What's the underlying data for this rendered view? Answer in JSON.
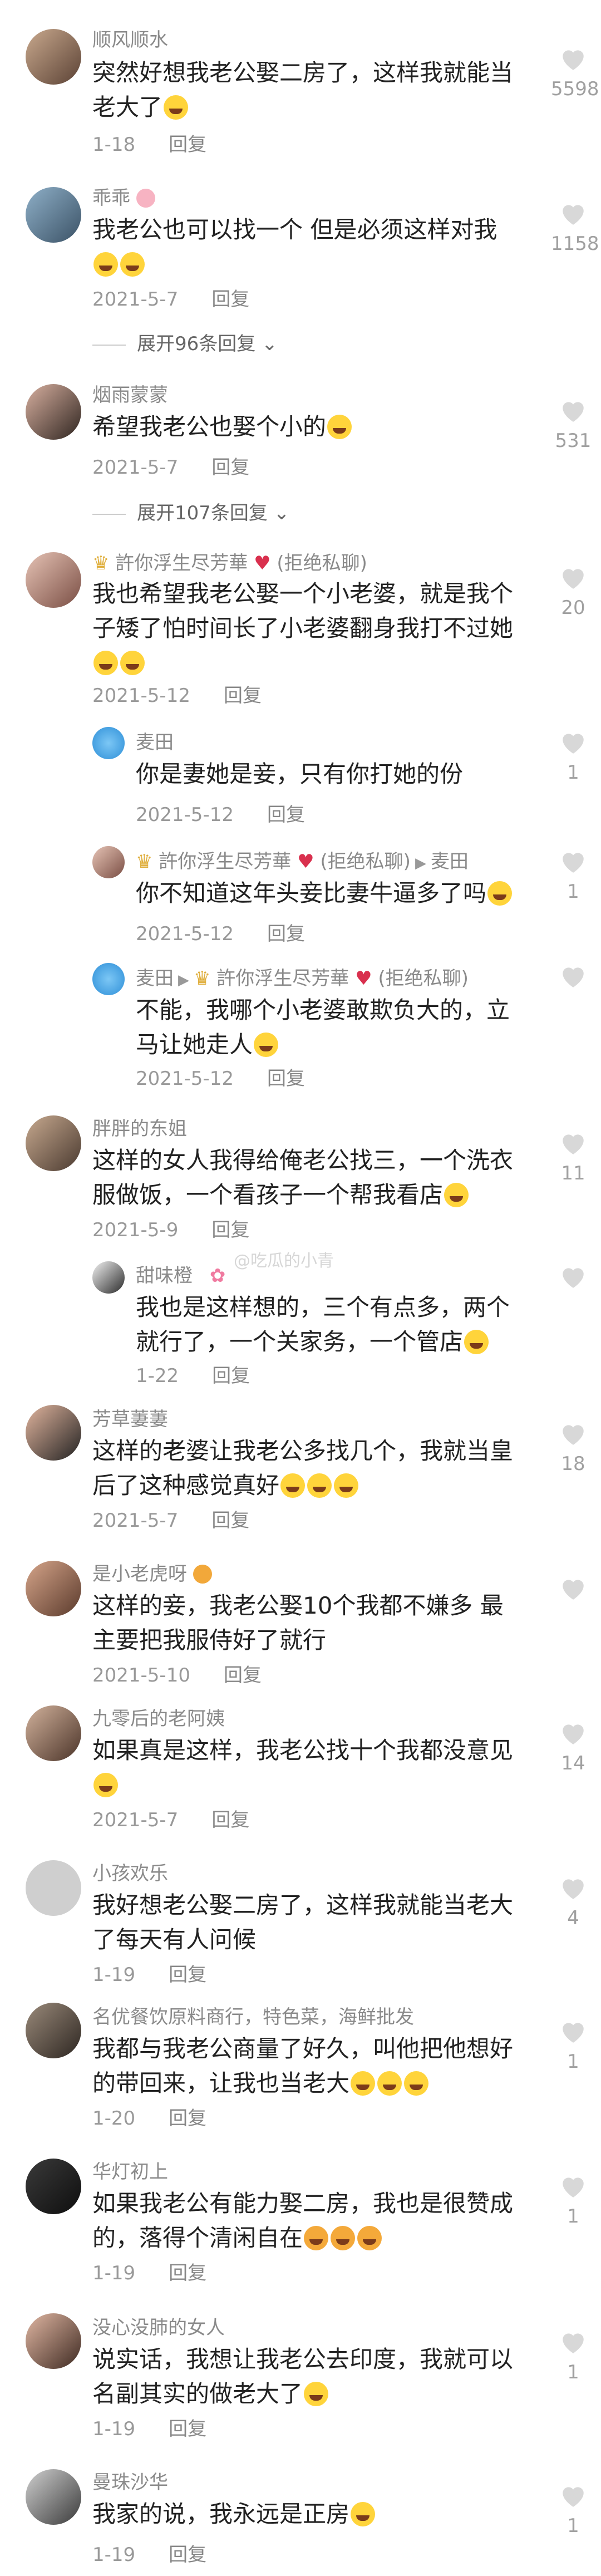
{
  "comments": [
    {
      "user": "顺风顺水",
      "text": "突然好想我老公娶二房了，这样我就能当老大了",
      "time": "1-18",
      "reply": "回复",
      "likes": "5598"
    },
    {
      "user": "乖乖",
      "text": "我老公也可以找一个 但是必须这样对我",
      "time": "2021-5-7",
      "reply": "回复",
      "likes": "1158",
      "expand": "展开96条回复"
    },
    {
      "user": "烟雨蒙蒙",
      "text": "希望我老公也娶个小的",
      "time": "2021-5-7",
      "reply": "回复",
      "likes": "531",
      "expand": "展开107条回复"
    },
    {
      "user": "許你浮生尽芳華",
      "user_suffix": "(拒绝私聊)",
      "text": "我也希望我老公娶一个小老婆，就是我个子矮了怕时间长了小老婆翻身我打不过她",
      "time": "2021-5-12",
      "reply": "回复",
      "likes": "20"
    },
    {
      "user": "麦田",
      "text": "你是妻她是妾，只有你打她的份",
      "time": "2021-5-12",
      "reply": "回复",
      "likes": "1"
    },
    {
      "user": "許你浮生尽芳華",
      "user_suffix": "(拒绝私聊)",
      "to": "麦田",
      "text": "你不知道这年头妾比妻牛逼多了吗",
      "time": "2021-5-12",
      "reply": "回复",
      "likes": "1"
    },
    {
      "user": "麦田",
      "to": "許你浮生尽芳華",
      "to_suffix": "(拒绝私聊)",
      "text": "不能，我哪个小老婆敢欺负大的，立马让她走人",
      "time": "2021-5-12",
      "reply": "回复",
      "likes": ""
    },
    {
      "user": "胖胖的东姐",
      "text": "这样的女人我得给俺老公找三，一个洗衣服做饭，一个看孩子一个帮我看店",
      "time": "2021-5-9",
      "reply": "回复",
      "likes": "11"
    },
    {
      "user": "甜味橙",
      "text": "我也是这样想的，三个有点多，两个就行了，一个关家务，一个管店",
      "time": "1-22",
      "reply": "回复",
      "likes": ""
    },
    {
      "user": "芳草萋萋",
      "text": "这样的老婆让我老公多找几个，我就当皇后了这种感觉真好",
      "time": "2021-5-7",
      "reply": "回复",
      "likes": "18"
    },
    {
      "user": "是小老虎呀",
      "text": "这样的妾，我老公娶10个我都不嫌多 最主要把我服侍好了就行",
      "time": "2021-5-10",
      "reply": "回复",
      "likes": ""
    },
    {
      "user": "九零后的老阿姨",
      "text": "如果真是这样，我老公找十个我都没意见",
      "time": "2021-5-7",
      "reply": "回复",
      "likes": "14"
    },
    {
      "user": "小孩欢乐",
      "text": "我好想老公娶二房了，这样我就能当老大了每天有人问候",
      "time": "1-19",
      "reply": "回复",
      "likes": "4"
    },
    {
      "user": "名优餐饮原料商行，特色菜，海鲜批发",
      "text": "我都与我老公商量了好久，叫他把他想好的带回来，让我也当老大",
      "time": "1-20",
      "reply": "回复",
      "likes": "1"
    },
    {
      "user": "华灯初上",
      "text": "如果我老公有能力娶二房，我也是很赞成的，落得个清闲自在",
      "time": "1-19",
      "reply": "回复",
      "likes": "1"
    },
    {
      "user": "没心没肺的女人",
      "text": "说实话，我想让我老公去印度，我就可以名副其实的做老大了",
      "time": "1-19",
      "reply": "回复",
      "likes": "1"
    },
    {
      "user": "曼珠沙华",
      "text": "我家的说，我永远是正房",
      "time": "1-19",
      "reply": "回复",
      "likes": "1"
    }
  ],
  "watermark": "@吃瓜的小青"
}
